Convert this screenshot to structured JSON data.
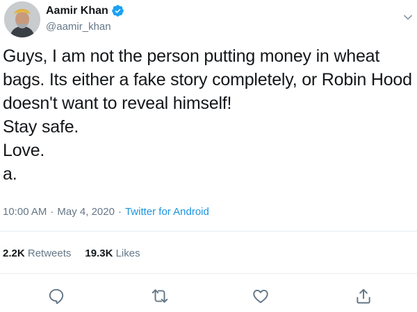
{
  "tweet": {
    "author": {
      "name": "Aamir Khan",
      "handle": "@aamir_khan",
      "verified": true
    },
    "text": "Guys, I am not the person putting money in wheat bags. Its either a fake story completely, or Robin Hood doesn't want to reveal himself!\nStay safe.\nLove.\na.",
    "time": "10:00 AM",
    "date": "May 4, 2020",
    "separator": "·",
    "source": "Twitter for Android",
    "stats": {
      "retweets_count": "2.2K",
      "retweets_label": "Retweets",
      "likes_count": "19.3K",
      "likes_label": "Likes"
    },
    "icons": [
      "reply-icon",
      "retweet-icon",
      "like-icon",
      "share-icon",
      "chevron-down-icon",
      "verified-badge-icon"
    ]
  },
  "colors": {
    "text": "#14171a",
    "muted": "#657786",
    "link": "#1b95e0",
    "verified": "#1da1f2",
    "divider": "#e6ecf0"
  }
}
